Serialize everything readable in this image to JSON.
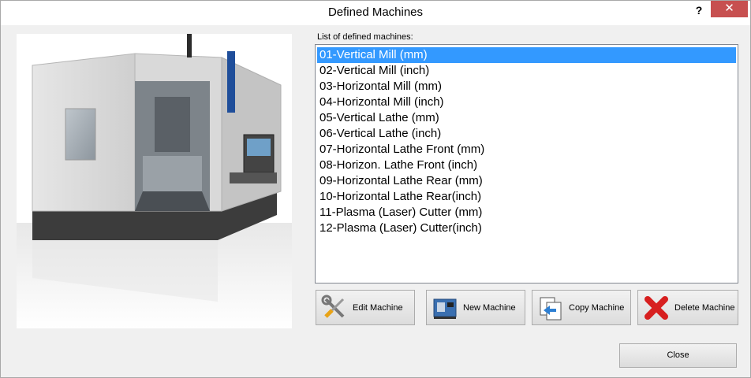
{
  "window": {
    "title": "Defined Machines",
    "help_label": "?",
    "close_glyph": "✕"
  },
  "list": {
    "label": "List of defined machines:",
    "items": [
      "01-Vertical Mill (mm)",
      "02-Vertical Mill (inch)",
      "03-Horizontal Mill (mm)",
      "04-Horizontal Mill (inch)",
      "05-Vertical Lathe (mm)",
      "06-Vertical Lathe (inch)",
      "07-Horizontal Lathe Front (mm)",
      "08-Horizon. Lathe Front (inch)",
      "09-Horizontal Lathe Rear (mm)",
      "10-Horizontal Lathe Rear(inch)",
      "11-Plasma (Laser) Cutter (mm)",
      "12-Plasma (Laser) Cutter(inch)"
    ],
    "selected_index": 0
  },
  "buttons": {
    "edit": "Edit Machine",
    "new": "New Machine",
    "copy": "Copy Machine",
    "delete": "Delete Machine",
    "close": "Close"
  },
  "colors": {
    "selection": "#3399ff",
    "close_button": "#c75050"
  },
  "icons": {
    "edit": "wrench-screwdriver-icon",
    "new": "cnc-machine-icon",
    "copy": "copy-document-icon",
    "delete": "red-x-icon"
  }
}
